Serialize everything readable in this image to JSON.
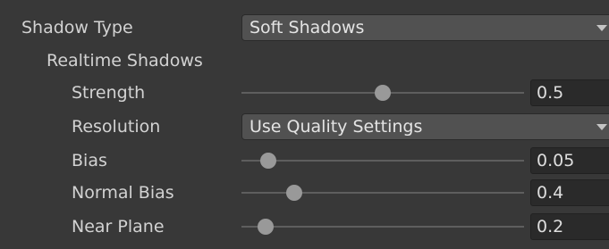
{
  "shadow_type": {
    "label": "Shadow Type",
    "value": "Soft Shadows"
  },
  "realtime_shadows": {
    "label": "Realtime Shadows"
  },
  "strength": {
    "label": "Strength",
    "value": "0.5",
    "slider_fraction": 0.5
  },
  "resolution": {
    "label": "Resolution",
    "value": "Use Quality Settings"
  },
  "bias": {
    "label": "Bias",
    "value": "0.05",
    "slider_fraction": 0.05
  },
  "normal_bias": {
    "label": "Normal Bias",
    "value": "0.4",
    "slider_fraction": 0.15
  },
  "near_plane": {
    "label": "Near Plane",
    "value": "0.2",
    "slider_fraction": 0.04
  },
  "colors": {
    "background": "#383838",
    "field": "#2a2a2a",
    "dropdown": "#515151",
    "thumb": "#999999",
    "text": "#d2d2d2"
  }
}
